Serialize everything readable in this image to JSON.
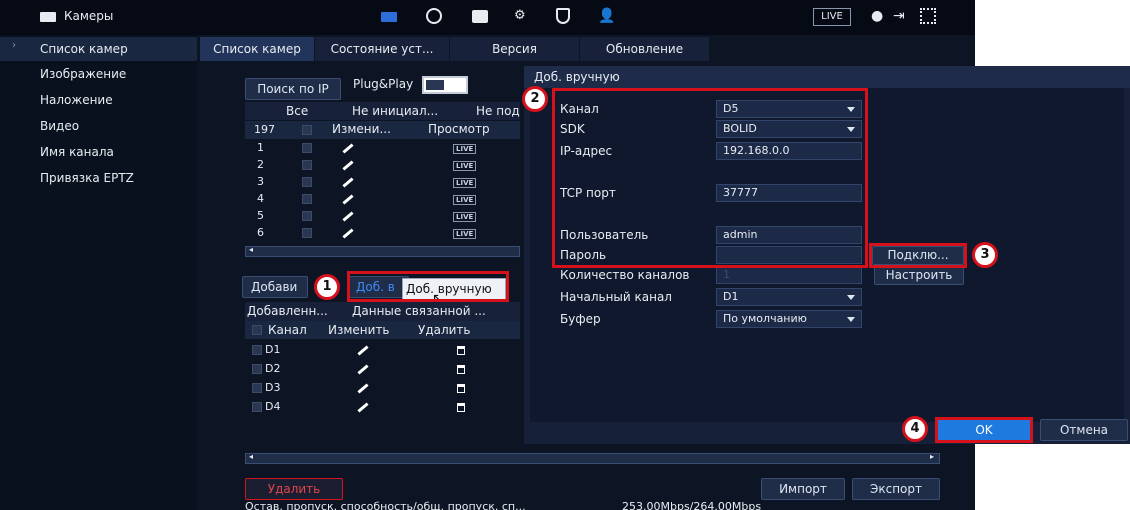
{
  "app": {
    "title": "Камеры",
    "live_badge": "LIVE"
  },
  "sidebar": {
    "items": [
      {
        "label": "Список камер"
      },
      {
        "label": "Изображение"
      },
      {
        "label": "Наложение"
      },
      {
        "label": "Видео"
      },
      {
        "label": "Имя канала"
      },
      {
        "label": "Привязка EPTZ"
      }
    ]
  },
  "tabs": [
    "Список камер",
    "Состояние уст...",
    "Версия",
    "Обновление"
  ],
  "search": {
    "search_ip_label": "Поиск по IP",
    "plug_play_label": "Plug&Play"
  },
  "device_list": {
    "filter_tabs": [
      "Все",
      "Не инициал...",
      "Не под"
    ],
    "count": "197",
    "columns": [
      "Измени...",
      "Просмотр"
    ],
    "rows": [
      "1",
      "2",
      "3",
      "4",
      "5",
      "6"
    ],
    "live_label": "LIVE"
  },
  "actions": {
    "add_label": "Добави",
    "manual_add_label": "Доб. в",
    "tooltip": "Доб. вручную"
  },
  "added_list": {
    "tabs": [
      "Добавленн...",
      "Данные связанной ..."
    ],
    "columns": [
      "Канал",
      "Изменить",
      "Удалить"
    ],
    "rows": [
      "D1",
      "D2",
      "D3",
      "D4"
    ]
  },
  "bottom": {
    "delete_label": "Удалить",
    "import_label": "Импорт",
    "export_label": "Экспорт",
    "bandwidth_label": "Остав. пропуск. способность/общ. пропуск. сп...",
    "bandwidth_value": "253.00Mbps/264.00Mbps"
  },
  "dialog": {
    "title": "Доб. вручную",
    "fields": {
      "channel_label": "Канал",
      "channel_value": "D5",
      "sdk_label": "SDK",
      "sdk_value": "BOLID",
      "ip_label": "IP-адрес",
      "ip_value": "192.168.0.0",
      "tcp_label": "TCP порт",
      "tcp_value": "37777",
      "user_label": "Пользователь",
      "user_value": "admin",
      "password_label": "Пароль",
      "password_value": "",
      "channel_count_label": "Количество каналов",
      "channel_count_value": "1",
      "start_channel_label": "Начальный канал",
      "start_channel_value": "D1",
      "buffer_label": "Буфер",
      "buffer_value": "По умолчанию"
    },
    "connect_label": "Подклю...",
    "configure_label": "Настроить",
    "ok_label": "OK",
    "cancel_label": "Отмена"
  },
  "callouts": [
    "1",
    "2",
    "3",
    "4"
  ],
  "colors": {
    "accent_red": "#d5121b",
    "ok_blue": "#1f7ae0",
    "link_blue": "#3d8bf2"
  }
}
